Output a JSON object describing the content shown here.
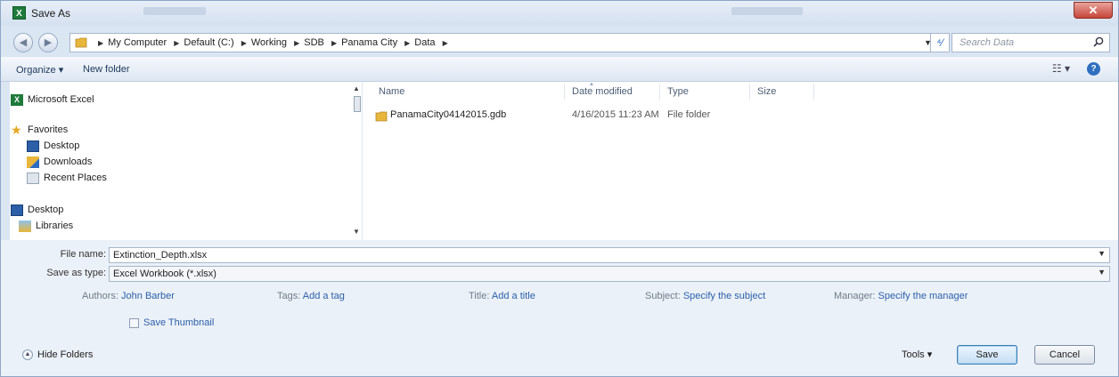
{
  "window": {
    "title": "Save As"
  },
  "nav": {
    "breadcrumb": [
      "My Computer",
      "Default (C:)",
      "Working",
      "SDB",
      "Panama City",
      "Data"
    ],
    "search_placeholder": "Search Data"
  },
  "toolbar": {
    "organize": "Organize ▾",
    "new_folder": "New folder"
  },
  "sidebar": {
    "top": "Microsoft Excel",
    "favorites_header": "Favorites",
    "favorites": [
      "Desktop",
      "Downloads",
      "Recent Places"
    ],
    "desktop": "Desktop",
    "libraries": "Libraries"
  },
  "file_list": {
    "columns": {
      "name": "Name",
      "date": "Date modified",
      "type": "Type",
      "size": "Size"
    },
    "rows": [
      {
        "name": "PanamaCity04142015.gdb",
        "date": "4/16/2015 11:23 AM",
        "type": "File folder",
        "size": ""
      }
    ]
  },
  "form": {
    "file_name_label": "File name:",
    "file_name_value": "Extinction_Depth.xlsx",
    "save_type_label": "Save as type:",
    "save_type_value": "Excel Workbook (*.xlsx)"
  },
  "metadata": {
    "authors_label": "Authors:",
    "authors_value": "John Barber",
    "tags_label": "Tags:",
    "tags_value": "Add a tag",
    "title_label": "Title:",
    "title_value": "Add a title",
    "subject_label": "Subject:",
    "subject_value": "Specify the subject",
    "manager_label": "Manager:",
    "manager_value": "Specify the manager"
  },
  "thumbnail_label": "Save Thumbnail",
  "thumbnail_checked": false,
  "hide_folders": "Hide Folders",
  "buttons": {
    "tools": "Tools ▾",
    "save": "Save",
    "cancel": "Cancel"
  },
  "colors": {
    "link": "#2c5fa8",
    "window_chrome": "#dbe6f3",
    "close": "#c6453a"
  },
  "icons": [
    "excel-icon",
    "star-icon",
    "desktop-icon",
    "downloads-icon",
    "recent-places-icon",
    "libraries-icon",
    "folder-icon",
    "search-icon",
    "help-icon"
  ]
}
